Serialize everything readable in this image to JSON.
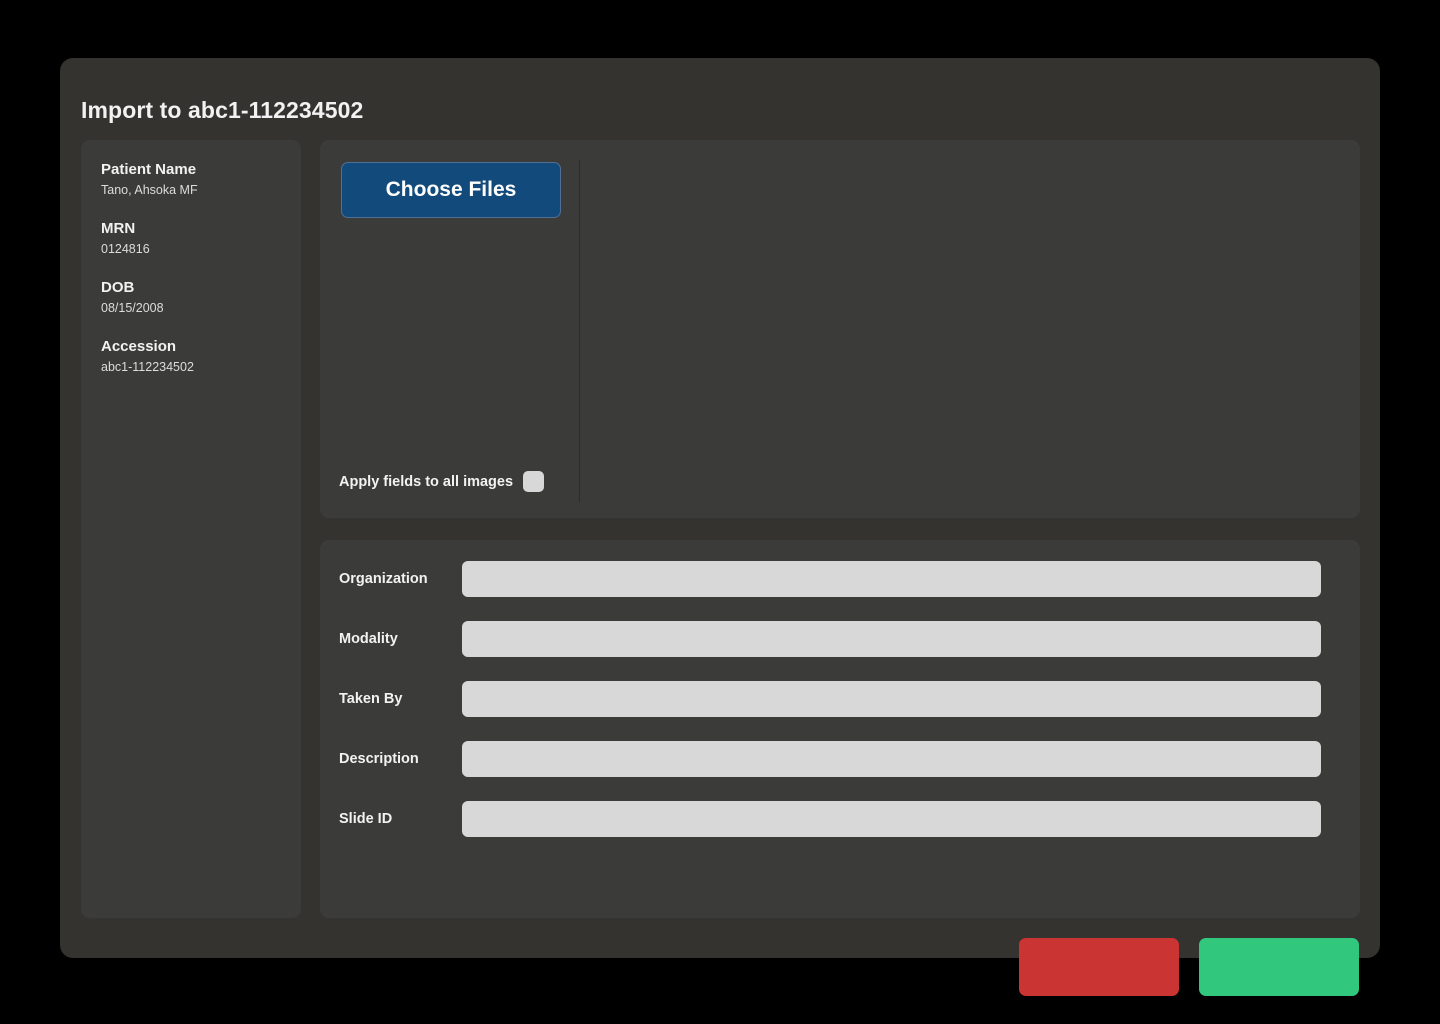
{
  "dialog": {
    "title": "Import to abc1-112234502"
  },
  "sidebar": {
    "fields": [
      {
        "label": "Patient Name",
        "value": "Tano, Ahsoka MF"
      },
      {
        "label": "MRN",
        "value": "0124816"
      },
      {
        "label": "DOB",
        "value": "08/15/2008"
      },
      {
        "label": "Accession",
        "value": "abc1-112234502"
      }
    ]
  },
  "upload": {
    "choose_files_label": "Choose Files",
    "apply_all_label": "Apply fields to all images",
    "apply_all_checked": false
  },
  "form": {
    "fields": [
      {
        "label": "Organization",
        "value": "",
        "placeholder": ""
      },
      {
        "label": "Modality",
        "value": "",
        "placeholder": ""
      },
      {
        "label": "Taken By",
        "value": "",
        "placeholder": ""
      },
      {
        "label": "Description",
        "value": "",
        "placeholder": ""
      },
      {
        "label": "Slide ID",
        "value": "",
        "placeholder": ""
      }
    ]
  },
  "footer": {
    "cancel_label": "",
    "confirm_label": ""
  },
  "colors": {
    "page_background": "#000000",
    "dialog_background": "#353330",
    "panel_background": "#3b3b39",
    "primary_button": "#134a7c",
    "input_background": "#d8d8d8",
    "cancel_button": "#ca3433",
    "confirm_button": "#31c87e",
    "text_primary": "#f2f2f2",
    "text_secondary": "#dcdcdc"
  }
}
